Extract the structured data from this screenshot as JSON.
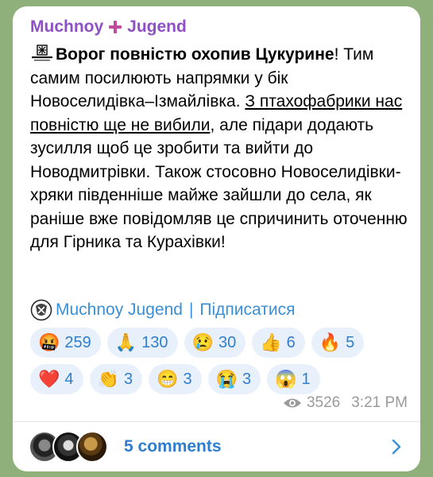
{
  "channel": {
    "name_left": "Muchnoy",
    "name_right": "Jugend",
    "accent_color": "#8e4fc7",
    "cross_color": "#c14a9f"
  },
  "message": {
    "lead_icon": "unit-emblem-icon",
    "bold_text": "Ворог повністю охопив Цукурине",
    "text_1": "! Тим самим  посилюють напрямки у бік Новоселидівка–Ізмайлівка. ",
    "underlined_text": "З птахофабрики нас повністю ще не вибили",
    "text_2": ", але підари додають зусилля щоб це зробити та вийти до Новодмитрівки. Також стосовно Новоселидівки- хряки південніше майже зайшли до села, як раніше вже повідомляв це спричинить оточенню для Гірника та Курахівки!"
  },
  "signature": {
    "name": "Muchnoy Jugend",
    "separator": "|",
    "subscribe_label": "Підписатися",
    "link_color": "#3a8fd6"
  },
  "reactions": {
    "row1": [
      {
        "emoji": "🤬",
        "count": "259"
      },
      {
        "emoji": "🙏",
        "count": "130"
      },
      {
        "emoji": "😢",
        "count": "30"
      },
      {
        "emoji": "👍",
        "count": "6"
      },
      {
        "emoji": "🔥",
        "count": "5"
      }
    ],
    "row2": [
      {
        "emoji": "❤️",
        "count": "4"
      },
      {
        "emoji": "👏",
        "count": "3"
      },
      {
        "emoji": "😁",
        "count": "3"
      },
      {
        "emoji": "😭",
        "count": "3"
      },
      {
        "emoji": "😱",
        "count": "1"
      }
    ]
  },
  "meta": {
    "views_icon": "eye-icon",
    "views": "3526",
    "time": "3:21 PM"
  },
  "comments": {
    "label": "5 comments",
    "chevron_icon": "chevron-right-icon"
  }
}
